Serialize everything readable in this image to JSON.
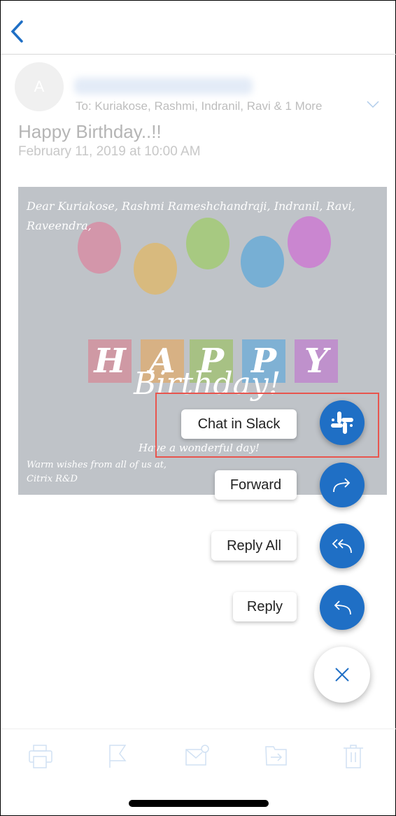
{
  "header": {
    "back_icon": "chevron-left-icon"
  },
  "message": {
    "avatar_initial": "A",
    "to": "To: Kuriakose, Rashmi, Indranil, Ravi & 1 More",
    "subject": "Happy Birthday..!!",
    "date": "February 11, 2019 at 10:00 AM",
    "card": {
      "greeting": "Dear Kuriakose, Rashmi Rameshchandraji, Indranil, Ravi, Raveendra,",
      "happy_letters": [
        "H",
        "A",
        "P",
        "P",
        "Y"
      ],
      "birthday": "Birthday!",
      "wish": "Have a wonderful day!",
      "footer_line1": "Warm wishes from all of us at,",
      "footer_line2": "Citrix R&D"
    }
  },
  "actions": [
    {
      "label": "Chat in Slack",
      "icon": "slack-icon"
    },
    {
      "label": "Forward",
      "icon": "forward-icon"
    },
    {
      "label": "Reply All",
      "icon": "reply-all-icon"
    },
    {
      "label": "Reply",
      "icon": "reply-icon"
    }
  ],
  "close_icon": "close-icon",
  "toolbar": [
    "print-icon",
    "flag-icon",
    "mark-unread-icon",
    "move-icon",
    "trash-icon"
  ],
  "colors": {
    "accent": "#1f6fc5",
    "highlight": "#e8554e"
  }
}
